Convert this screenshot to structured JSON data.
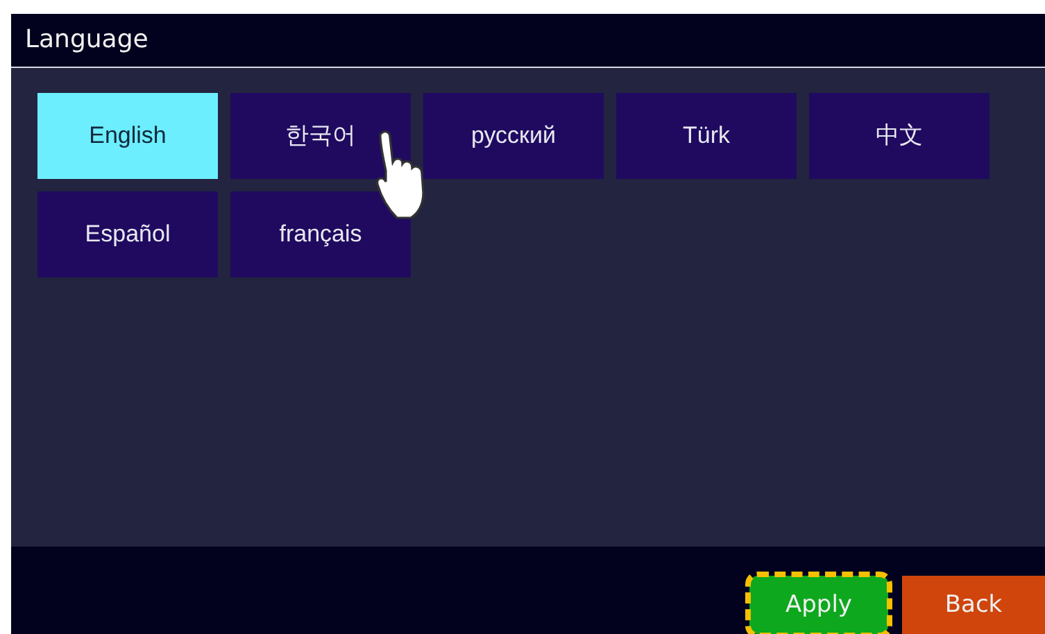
{
  "header": {
    "title": "Language"
  },
  "languages": [
    {
      "label": "English",
      "selected": true
    },
    {
      "label": "한국어",
      "selected": false
    },
    {
      "label": "русский",
      "selected": false
    },
    {
      "label": "Türk",
      "selected": false
    },
    {
      "label": "中文",
      "selected": false
    },
    {
      "label": "Español",
      "selected": false
    },
    {
      "label": "français",
      "selected": false
    }
  ],
  "footer": {
    "buttons": [
      {
        "label": "Apply",
        "kind": "apply",
        "focused": true
      },
      {
        "label": "Back",
        "kind": "back",
        "focused": false
      }
    ]
  }
}
